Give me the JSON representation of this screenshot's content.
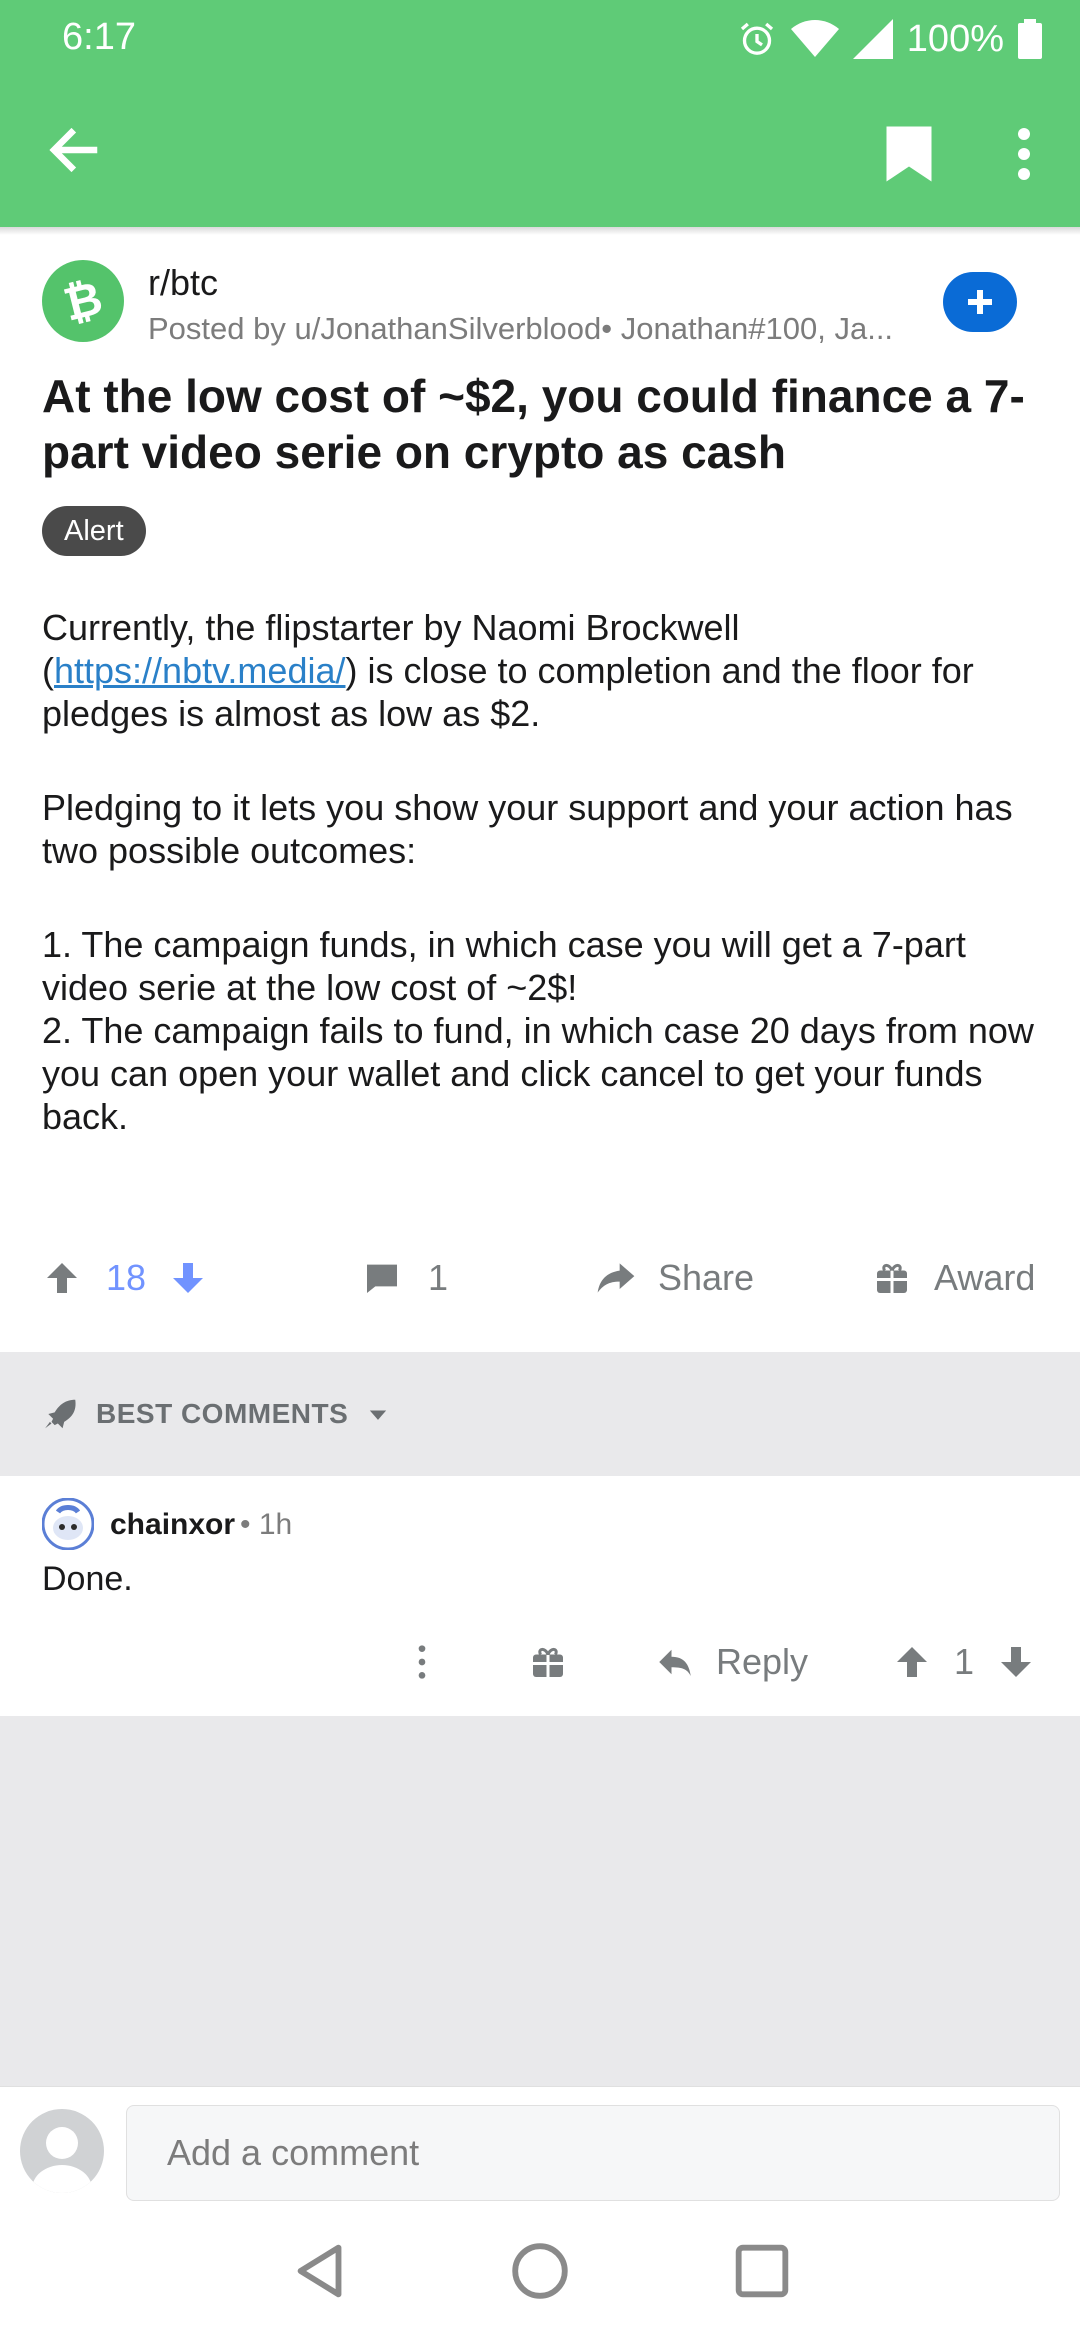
{
  "status_bar": {
    "time": "6:17",
    "battery": "100%",
    "icons": [
      "alarm-icon",
      "wifi-icon",
      "signal-icon",
      "battery-icon"
    ]
  },
  "toolbar": {
    "icons": [
      "back-arrow-icon",
      "bookmark-icon",
      "more-vert-icon"
    ],
    "color": "#5fcb77"
  },
  "post": {
    "subreddit": "r/btc",
    "posted_by": "Posted by u/JonathanSilverblood• Jonathan#100, Ja...",
    "title": "At the low cost of ~$2, you could finance a 7-part video serie on crypto as cash",
    "flair": "Alert",
    "body": {
      "p1_before": "Currently, the flipstarter by Naomi Brockwell (",
      "p1_link": "https://nbtv.media/",
      "p1_after": ") is close to completion and the floor for pledges is almost as low as $2.",
      "p2": "Pledging to it lets you show your support and your action has two possible outcomes:",
      "item1": "1. The campaign funds, in which case you will get a 7-part video serie at the low cost of ~2$!",
      "item2": "2. The campaign fails to fund, in which case 20 days from now you can open your wallet and click cancel to get your funds back."
    },
    "score": "18",
    "comments_count": "1",
    "share_label": "Share",
    "award_label": "Award"
  },
  "comments_section": {
    "sort_label": "BEST COMMENTS"
  },
  "comments": [
    {
      "author": "chainxor",
      "time": "• 1h",
      "body": "Done.",
      "reply_label": "Reply",
      "score": "1"
    }
  ],
  "composer": {
    "placeholder": "Add a comment"
  },
  "colors": {
    "accent": "#5fcb77",
    "upvote": "#7193ff",
    "join": "#0a6bd6",
    "link": "#2a80c8"
  }
}
